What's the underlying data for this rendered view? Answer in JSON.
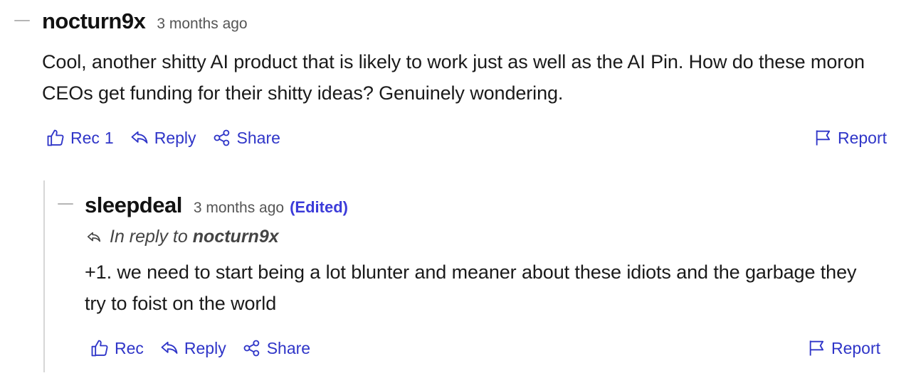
{
  "comments": [
    {
      "username": "nocturn9x",
      "timestamp": "3 months ago",
      "body": "Cool, another shitty AI product that is likely to work just as well as the AI Pin. How do these moron CEOs get funding for their shitty ideas? Genuinely wondering.",
      "actions": {
        "rec_label": "Rec",
        "rec_count": "1",
        "reply_label": "Reply",
        "share_label": "Share",
        "report_label": "Report"
      }
    },
    {
      "username": "sleepdeal",
      "timestamp": "3 months ago",
      "edited": "(Edited)",
      "reply_to_prefix": "In reply to",
      "reply_to_user": "nocturn9x",
      "body": "+1. we need to start being a lot blunter and meaner about these idiots and the garbage they try to foist on the world",
      "actions": {
        "rec_label": "Rec",
        "reply_label": "Reply",
        "share_label": "Share",
        "report_label": "Report"
      }
    }
  ],
  "colors": {
    "accent": "#2f35c8",
    "edited": "#3b3bd9",
    "username": "#121212",
    "meta": "#555555"
  },
  "icons": {
    "rec": "thumbs-up-icon",
    "reply": "reply-arrow-icon",
    "share": "share-nodes-icon",
    "report": "flag-icon"
  }
}
